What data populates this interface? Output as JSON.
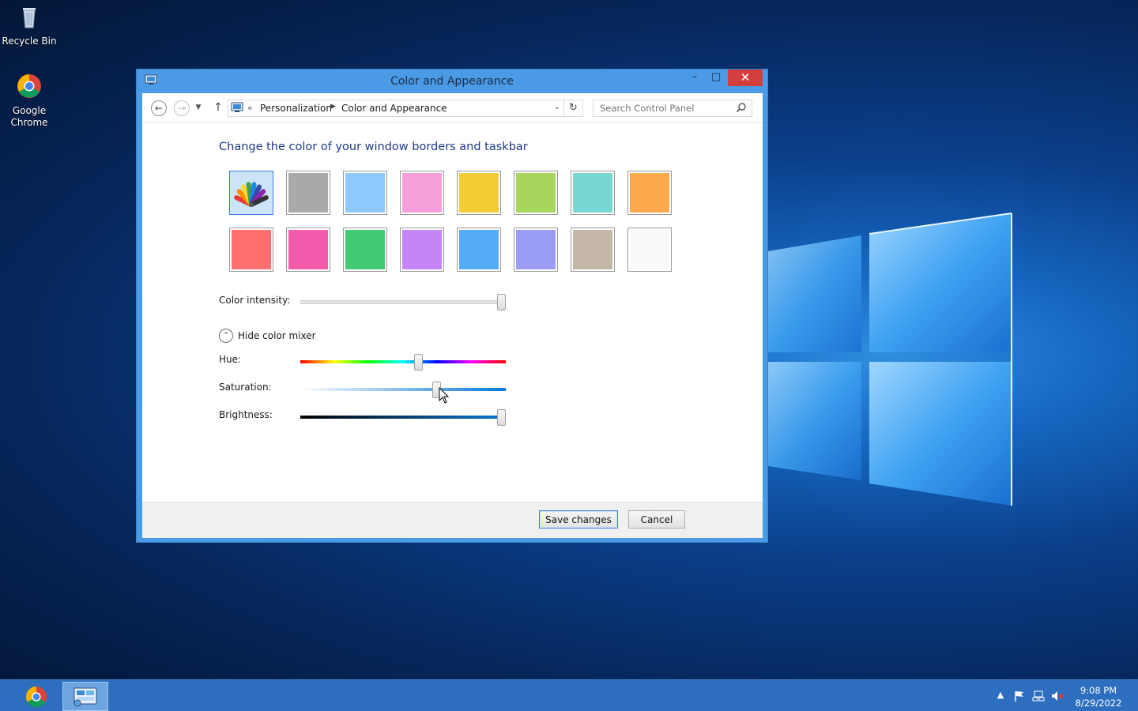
{
  "desktop": {
    "icons": [
      {
        "label": "Recycle Bin"
      },
      {
        "label": "Google Chrome"
      }
    ]
  },
  "window": {
    "title": "Color and Appearance",
    "controls": {
      "minimize": "–",
      "maximize": "□",
      "close": "✕"
    },
    "nav": {
      "breadcrumb_chevron": "«",
      "breadcrumb": [
        "Personalization",
        "Color and Appearance"
      ],
      "search_placeholder": "Search Control Panel"
    },
    "heading": "Change the color of your window borders and taskbar",
    "swatches": [
      {
        "color": "automatic"
      },
      {
        "color": "#a9a9a9"
      },
      {
        "color": "#8fc8fa"
      },
      {
        "color": "#f49fd7"
      },
      {
        "color": "#f2cd36"
      },
      {
        "color": "#a6d65e"
      },
      {
        "color": "#77d7d2"
      },
      {
        "color": "#ffa94d"
      },
      {
        "color": "#fe7070"
      },
      {
        "color": "#f35cac"
      },
      {
        "color": "#43cb73"
      },
      {
        "color": "#c486f7"
      },
      {
        "color": "#56abf5"
      },
      {
        "color": "#9a9cf6"
      },
      {
        "color": "#c5b7a8"
      },
      {
        "color": "#fafafa"
      }
    ],
    "selected_swatch": 0,
    "color_intensity": {
      "label": "Color intensity:",
      "value": 1.0
    },
    "mixer_toggle": {
      "label": "Hide color mixer",
      "icon": "chevron-up-icon"
    },
    "hue": {
      "label": "Hue:",
      "value": 0.58
    },
    "saturation": {
      "label": "Saturation:",
      "value": 0.67
    },
    "brightness": {
      "label": "Brightness:",
      "value": 1.0
    },
    "buttons": {
      "save": "Save changes",
      "cancel": "Cancel"
    }
  },
  "taskbar": {
    "clock_time": "9:08 PM",
    "clock_date": "8/29/2022"
  },
  "colors": {
    "titlebar": "#4a9ae6",
    "heading": "#1e3a8a",
    "close_button": "#d33f3f",
    "taskbar": "#2d6fbe"
  }
}
